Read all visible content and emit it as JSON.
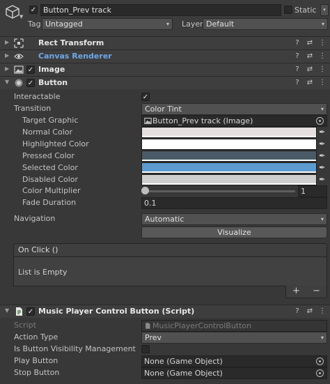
{
  "header": {
    "name": "Button_Prev track",
    "active": true,
    "static_label": "Static",
    "tag_label": "Tag",
    "tag_value": "Untagged",
    "layer_label": "Layer",
    "layer_value": "Default"
  },
  "components": {
    "rect_transform": {
      "title": "Rect Transform"
    },
    "canvas_renderer": {
      "title": "Canvas Renderer"
    },
    "image": {
      "title": "Image",
      "enabled": true
    },
    "button": {
      "title": "Button",
      "enabled": true
    },
    "script": {
      "title": "Music Player Control Button (Script)",
      "enabled": true
    }
  },
  "button_props": {
    "interactable_label": "Interactable",
    "interactable": true,
    "transition_label": "Transition",
    "transition_value": "Color Tint",
    "target_graphic_label": "Target Graphic",
    "target_graphic_value": "Button_Prev track (Image)",
    "normal_color_label": "Normal Color",
    "highlighted_color_label": "Highlighted Color",
    "pressed_color_label": "Pressed Color",
    "selected_color_label": "Selected Color",
    "disabled_color_label": "Disabled Color",
    "color_multiplier_label": "Color Multiplier",
    "color_multiplier_value": "1",
    "color_multiplier_fraction": 0.0,
    "fade_duration_label": "Fade Duration",
    "fade_duration_value": "0.1",
    "navigation_label": "Navigation",
    "navigation_value": "Automatic",
    "visualize_label": "Visualize",
    "on_click_label": "On Click ()",
    "list_empty_label": "List is Empty",
    "add_label": "+",
    "remove_label": "−"
  },
  "colors": {
    "normal": "#e6dfdf",
    "highlighted": "#ffffff",
    "pressed": "#4a5a66",
    "selected": "#5c9bcf",
    "disabled": "#cfcfcf"
  },
  "script_props": {
    "script_label": "Script",
    "script_value": "MusicPlayerControlButton",
    "action_type_label": "Action Type",
    "action_type_value": "Prev",
    "visibility_label": "Is Button Visibility Management",
    "visibility_value": false,
    "play_button_label": "Play Button",
    "play_button_value": "None (Game Object)",
    "stop_button_label": "Stop Button",
    "stop_button_value": "None (Game Object)"
  },
  "icons": {
    "help": "?",
    "presets": "⇄",
    "menu": "⋮",
    "check": "✓",
    "dropdown": "▾",
    "foldout_closed": "▶",
    "foldout_open": "▼",
    "eyedropper": "✒"
  }
}
